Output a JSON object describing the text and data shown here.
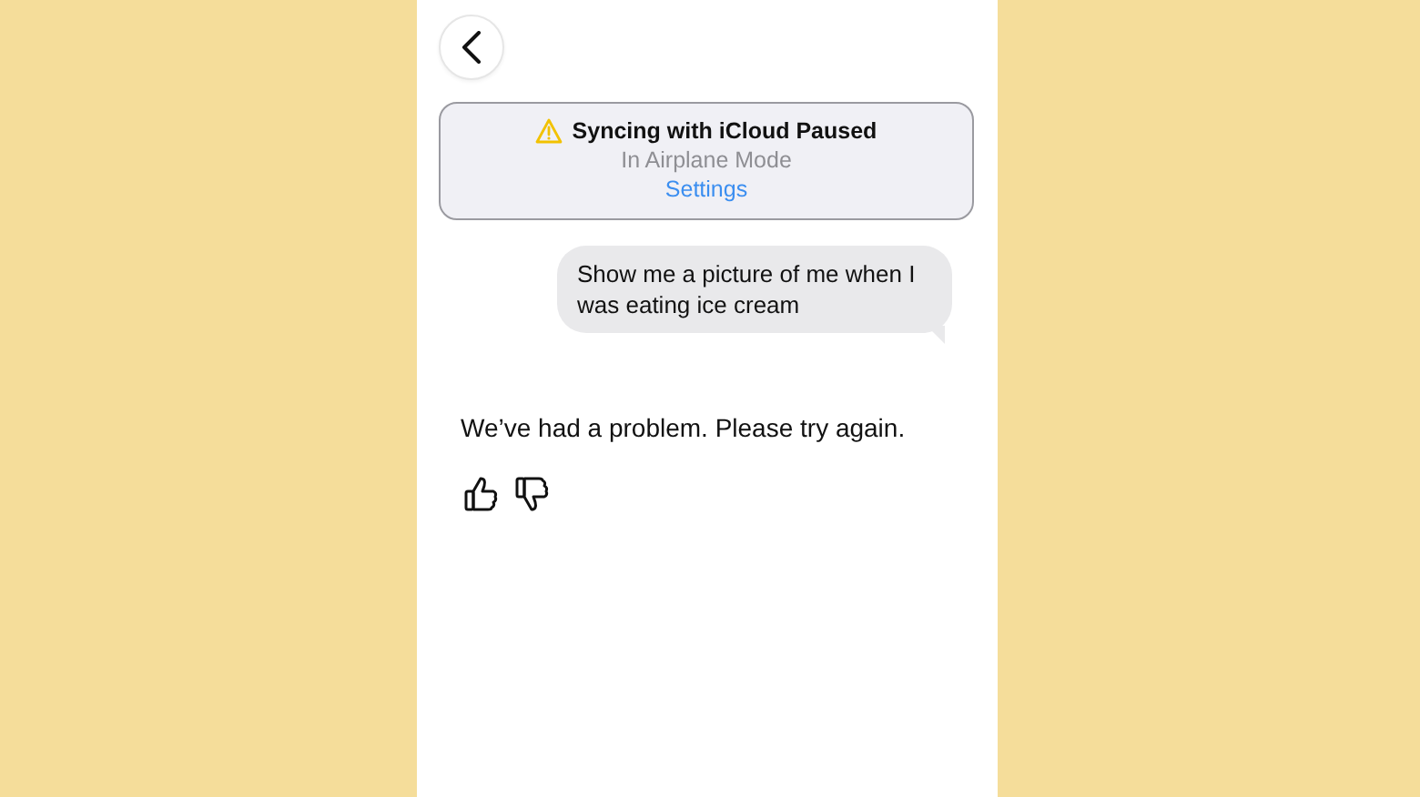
{
  "banner": {
    "title": "Syncing with iCloud Paused",
    "subtitle": "In Airplane Mode",
    "link": "Settings"
  },
  "messages": [
    {
      "kind": "user",
      "text": "Show me a picture of me when I was eating ice cream"
    },
    {
      "kind": "assistant",
      "text": "We’ve had a problem. Please try again."
    }
  ]
}
